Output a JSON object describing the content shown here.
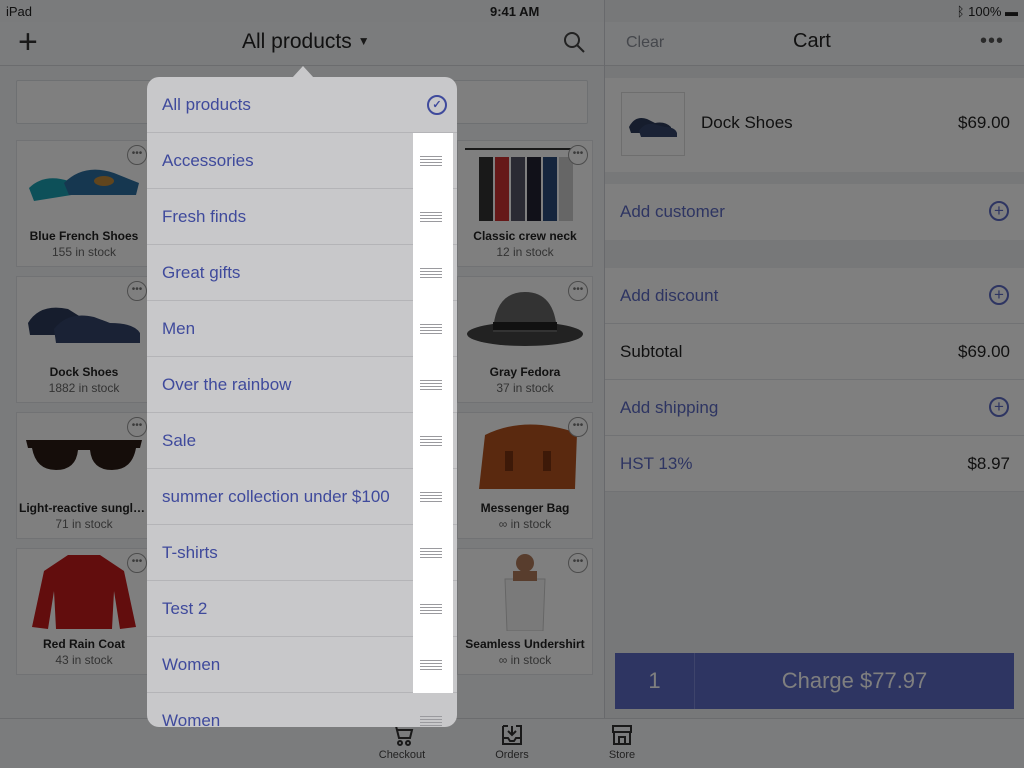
{
  "status_bar": {
    "device": "iPad",
    "time": "9:41 AM",
    "battery": "100%"
  },
  "products_nav": {
    "title": "All products"
  },
  "products": [
    {
      "name": "Blue French Shoes",
      "stock": "155 in stock"
    },
    {
      "name": "Classic crew neck",
      "stock": "12 in stock"
    },
    {
      "name": "Dock Shoes",
      "stock": "1882 in stock"
    },
    {
      "name": "Gray Fedora",
      "stock": "37 in stock"
    },
    {
      "name": "Light-reactive sunglasses",
      "stock": "71 in stock"
    },
    {
      "name": "Messenger Bag",
      "stock": "∞ in stock"
    },
    {
      "name": "Red Rain Coat",
      "stock": "43 in stock"
    },
    {
      "name": "Seamless Undershirt",
      "stock": "∞ in stock"
    }
  ],
  "collections_popover": {
    "selected": "All products",
    "items": [
      "Accessories",
      "Fresh finds",
      "Great gifts",
      "Men",
      "Over the rainbow",
      "Sale",
      "summer collection under $100",
      "T-shirts",
      "Test 2",
      "Women",
      "Women"
    ]
  },
  "cart": {
    "clear_label": "Clear",
    "title": "Cart",
    "more_label": "•••",
    "line_item": {
      "name": "Dock Shoes",
      "price": "$69.00"
    },
    "add_customer": "Add customer",
    "add_discount": "Add discount",
    "subtotal_label": "Subtotal",
    "subtotal": "$69.00",
    "add_shipping": "Add shipping",
    "tax_label": "HST 13%",
    "tax": "$8.97",
    "quantity": "1",
    "charge_label": "Charge $77.97"
  },
  "tabs": [
    "Checkout",
    "Orders",
    "Store"
  ],
  "colors": {
    "accent": "#5c6ac4"
  }
}
